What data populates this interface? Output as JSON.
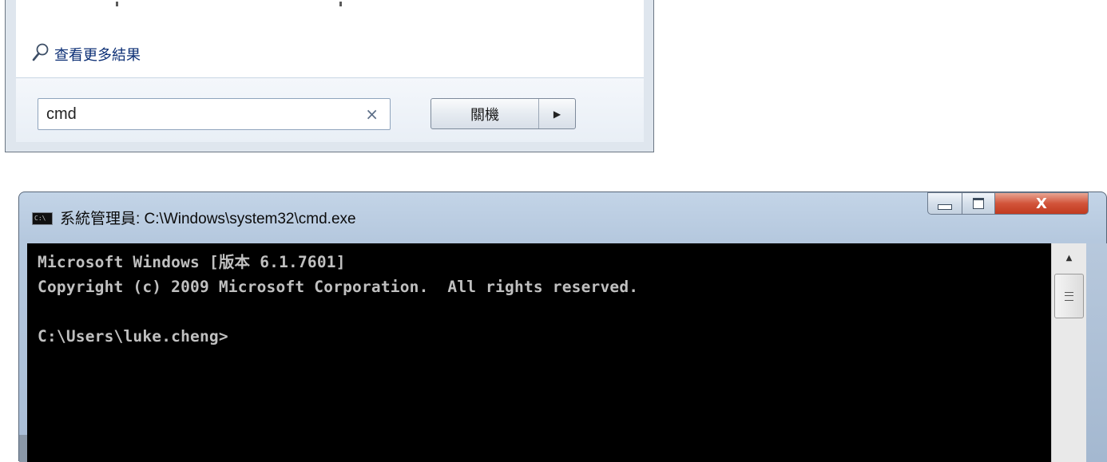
{
  "start_menu": {
    "more_results_label": "查看更多結果",
    "search": {
      "value": "cmd",
      "clear_glyph": "×"
    },
    "shutdown": {
      "label": "關機",
      "arrow_glyph": "▶"
    },
    "icons": {
      "search": "magnifier-icon"
    }
  },
  "cmd_window": {
    "title": "系統管理員: C:\\Windows\\system32\\cmd.exe",
    "icon_text": "C:\\",
    "controls": {
      "minimize": "minimize-icon",
      "maximize": "maximize-icon",
      "close_glyph": "X"
    },
    "console_lines": [
      "Microsoft Windows [版本 6.1.7601]",
      "Copyright (c) 2009 Microsoft Corporation.  All rights reserved.",
      "",
      "C:\\Users\\luke.cheng>"
    ],
    "scrollbar": {
      "up_glyph": "▲"
    }
  },
  "colors": {
    "console_bg": "#000000",
    "console_fg": "#c0c0c0",
    "close_button": "#c74a30",
    "link_text": "#0c2f75"
  }
}
